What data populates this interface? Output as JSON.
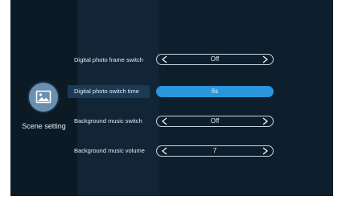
{
  "sidebar": {
    "icon": "picture-icon",
    "label": "Scene setting"
  },
  "settings": [
    {
      "label": "Digital photo frame switch",
      "value": "Off"
    },
    {
      "label": "Digital photo switch time",
      "value": "6s"
    },
    {
      "label": "Background music switch",
      "value": "Off"
    },
    {
      "label": "Background music volume",
      "value": "7"
    }
  ],
  "colors": {
    "accent": "#2a96dc",
    "background": "#0d1f2d",
    "sidebar": "#0b1a25"
  }
}
